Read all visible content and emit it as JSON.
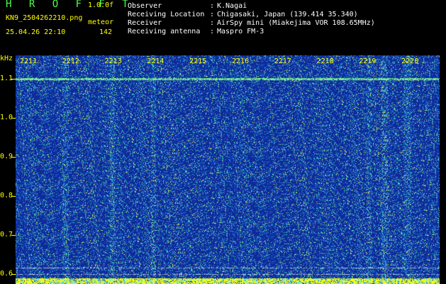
{
  "header": {
    "app_title": "H R O F F T",
    "app_version": "1.0.0f",
    "file_name": "KN9_2504262210.png",
    "detection_label": "meteor",
    "datetime": "25.04.26 22:10",
    "meteor_count": "142",
    "info": [
      {
        "key": "Observer",
        "value": "K.Nagai"
      },
      {
        "key": "Receiving Location",
        "value": "Chigasaki, Japan (139.414 35.340)"
      },
      {
        "key": "Receiver",
        "value": "AirSpy mini (Miakejima VOR 108.65MHz)"
      },
      {
        "key": "Receiving antenna",
        "value": "Maspro FM-3"
      }
    ],
    "separator": ":"
  },
  "axis": {
    "unit": "kHz",
    "freq_labels": [
      "1.1",
      "1.0",
      "0.9",
      "0.8",
      "0.7",
      "0.6"
    ],
    "freq_values": [
      1.1,
      1.0,
      0.9,
      0.8,
      0.7,
      0.6
    ],
    "freq_range": [
      0.575,
      1.16
    ],
    "time_labels": [
      "2211",
      "2212",
      "2213",
      "2214",
      "2215",
      "2216",
      "2217",
      "2218",
      "2219",
      "2220"
    ]
  },
  "colors": {
    "background": "#0f2a9a",
    "label": "#ffff00",
    "title": "#4cff4c",
    "text": "#ffffff"
  }
}
